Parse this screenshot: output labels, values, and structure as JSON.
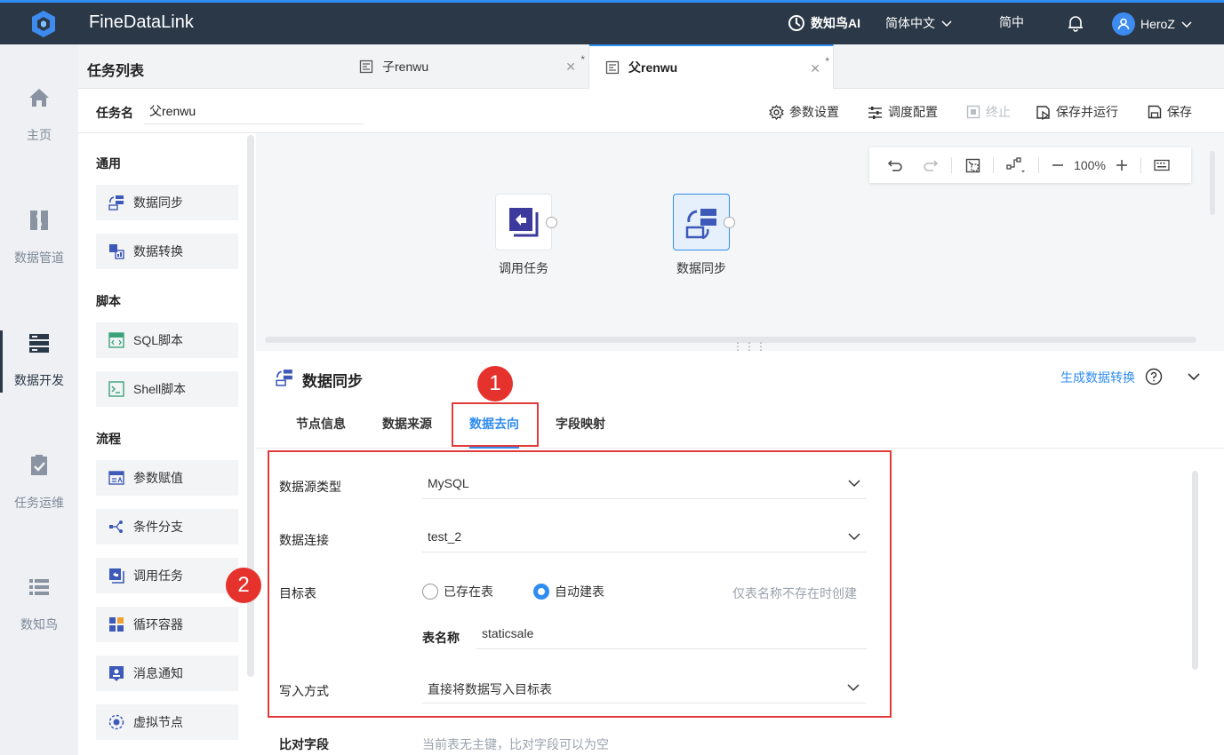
{
  "topbar": {
    "brand": "FineDataLink",
    "ai_label": "数知鸟AI",
    "language": "简体中文",
    "simplified": "简中",
    "user": "HeroZ"
  },
  "nav": [
    {
      "label": "主页",
      "icon": "home-icon"
    },
    {
      "label": "数据管道",
      "icon": "pipeline-icon"
    },
    {
      "label": "数据开发",
      "icon": "server-icon",
      "active": true
    },
    {
      "label": "任务运维",
      "icon": "clipboard-check-icon"
    },
    {
      "label": "数知鸟",
      "icon": "list-icon"
    }
  ],
  "tasklist_title": "任务列表",
  "tabs": [
    {
      "label": "子renwu",
      "star": "*"
    },
    {
      "label": "父renwu",
      "star": "*",
      "active": true
    }
  ],
  "namebar": {
    "label": "任务名",
    "value": "父renwu",
    "buttons": {
      "params": "参数设置",
      "schedule": "调度配置",
      "stop": "终止",
      "save_run": "保存并运行",
      "save": "保存"
    }
  },
  "palette": {
    "groups": [
      "通用",
      "脚本",
      "流程"
    ],
    "items": [
      "数据同步",
      "数据转换",
      "SQL脚本",
      "Shell脚本",
      "参数赋值",
      "条件分支",
      "调用任务",
      "循环容器",
      "消息通知",
      "虚拟节点"
    ]
  },
  "canvas": {
    "zoom": "100%",
    "nodes": [
      "调用任务",
      "数据同步"
    ]
  },
  "panel": {
    "title": "数据同步",
    "generate_link": "生成数据转换",
    "tabs": [
      "节点信息",
      "数据来源",
      "数据去向",
      "字段映射"
    ],
    "markers": [
      "1",
      "2"
    ],
    "form": {
      "source_type_label": "数据源类型",
      "source_type_value": "MySQL",
      "connection_label": "数据连接",
      "connection_value": "test_2",
      "target_label": "目标表",
      "radio_existing": "已存在表",
      "radio_auto": "自动建表",
      "auto_hint": "仅表名称不存在时创建",
      "table_name_label": "表名称",
      "table_name_value": "staticsale",
      "write_mode_label": "写入方式",
      "write_mode_value": "直接将数据写入目标表",
      "compare_label": "比对字段",
      "compare_hint": "当前表无主键，比对字段可以为空"
    }
  },
  "colors": {
    "accent": "#2f8cf0",
    "topbar": "#2b3848",
    "highlight": "#e03a3a"
  }
}
